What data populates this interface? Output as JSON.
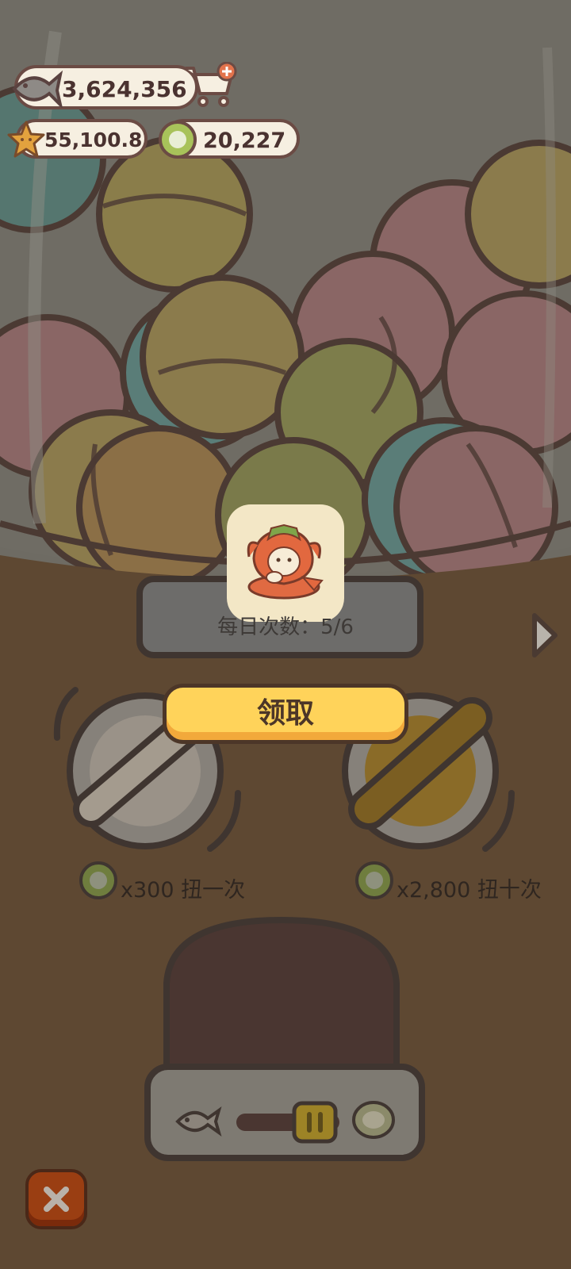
{
  "currencies": {
    "fish": {
      "value": "3,624,356",
      "icon": "fish-icon",
      "action_icon": "cart-add-icon"
    },
    "star": {
      "value": "55,100.8",
      "icon": "star-icon"
    },
    "coin": {
      "value": "20,227",
      "icon": "green-coin-icon"
    }
  },
  "machine": {
    "daily_count_label": "每日次数：5/6",
    "claim_label": "领取",
    "reward_icon": "strawberry-bunny-figure",
    "next_icon": "next-arrow-icon"
  },
  "draws": [
    {
      "cost_text": "x300 扭一次",
      "icon": "green-coin-icon"
    },
    {
      "cost_text": "x2,800 扭十次",
      "icon": "green-coin-icon"
    }
  ],
  "slider": {
    "left_icon": "fish-icon",
    "right_icon": "green-coin-icon",
    "handle_icon": "pause-handle-icon"
  },
  "close": {
    "icon": "close-icon"
  },
  "colors": {
    "overlay": "#5a4631",
    "claim": "#ffd35a",
    "card": "#f3e7c6",
    "close": "#9a3e12"
  }
}
